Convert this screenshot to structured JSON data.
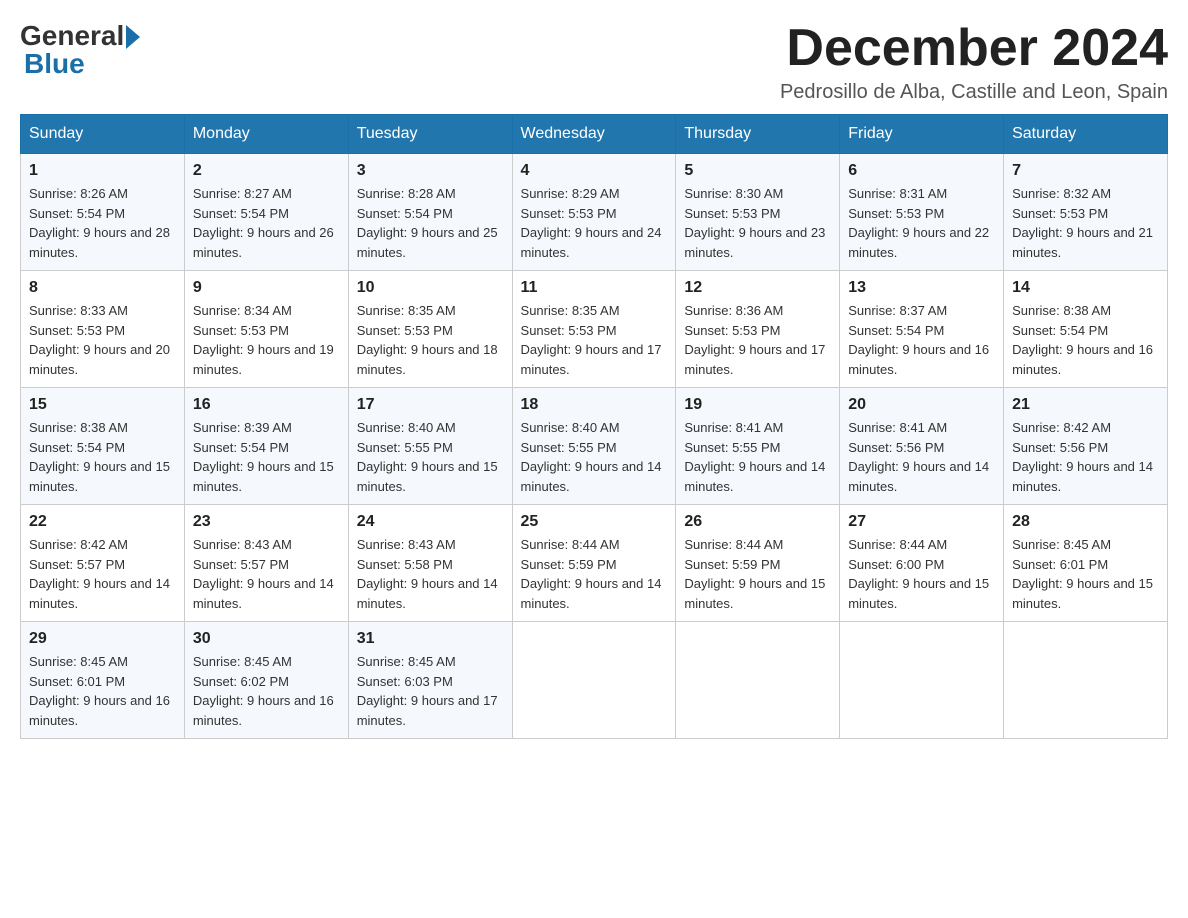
{
  "logo": {
    "general": "General",
    "blue": "Blue"
  },
  "title": "December 2024",
  "location": "Pedrosillo de Alba, Castille and Leon, Spain",
  "days_of_week": [
    "Sunday",
    "Monday",
    "Tuesday",
    "Wednesday",
    "Thursday",
    "Friday",
    "Saturday"
  ],
  "weeks": [
    [
      {
        "day": "1",
        "sunrise": "8:26 AM",
        "sunset": "5:54 PM",
        "daylight": "9 hours and 28 minutes."
      },
      {
        "day": "2",
        "sunrise": "8:27 AM",
        "sunset": "5:54 PM",
        "daylight": "9 hours and 26 minutes."
      },
      {
        "day": "3",
        "sunrise": "8:28 AM",
        "sunset": "5:54 PM",
        "daylight": "9 hours and 25 minutes."
      },
      {
        "day": "4",
        "sunrise": "8:29 AM",
        "sunset": "5:53 PM",
        "daylight": "9 hours and 24 minutes."
      },
      {
        "day": "5",
        "sunrise": "8:30 AM",
        "sunset": "5:53 PM",
        "daylight": "9 hours and 23 minutes."
      },
      {
        "day": "6",
        "sunrise": "8:31 AM",
        "sunset": "5:53 PM",
        "daylight": "9 hours and 22 minutes."
      },
      {
        "day": "7",
        "sunrise": "8:32 AM",
        "sunset": "5:53 PM",
        "daylight": "9 hours and 21 minutes."
      }
    ],
    [
      {
        "day": "8",
        "sunrise": "8:33 AM",
        "sunset": "5:53 PM",
        "daylight": "9 hours and 20 minutes."
      },
      {
        "day": "9",
        "sunrise": "8:34 AM",
        "sunset": "5:53 PM",
        "daylight": "9 hours and 19 minutes."
      },
      {
        "day": "10",
        "sunrise": "8:35 AM",
        "sunset": "5:53 PM",
        "daylight": "9 hours and 18 minutes."
      },
      {
        "day": "11",
        "sunrise": "8:35 AM",
        "sunset": "5:53 PM",
        "daylight": "9 hours and 17 minutes."
      },
      {
        "day": "12",
        "sunrise": "8:36 AM",
        "sunset": "5:53 PM",
        "daylight": "9 hours and 17 minutes."
      },
      {
        "day": "13",
        "sunrise": "8:37 AM",
        "sunset": "5:54 PM",
        "daylight": "9 hours and 16 minutes."
      },
      {
        "day": "14",
        "sunrise": "8:38 AM",
        "sunset": "5:54 PM",
        "daylight": "9 hours and 16 minutes."
      }
    ],
    [
      {
        "day": "15",
        "sunrise": "8:38 AM",
        "sunset": "5:54 PM",
        "daylight": "9 hours and 15 minutes."
      },
      {
        "day": "16",
        "sunrise": "8:39 AM",
        "sunset": "5:54 PM",
        "daylight": "9 hours and 15 minutes."
      },
      {
        "day": "17",
        "sunrise": "8:40 AM",
        "sunset": "5:55 PM",
        "daylight": "9 hours and 15 minutes."
      },
      {
        "day": "18",
        "sunrise": "8:40 AM",
        "sunset": "5:55 PM",
        "daylight": "9 hours and 14 minutes."
      },
      {
        "day": "19",
        "sunrise": "8:41 AM",
        "sunset": "5:55 PM",
        "daylight": "9 hours and 14 minutes."
      },
      {
        "day": "20",
        "sunrise": "8:41 AM",
        "sunset": "5:56 PM",
        "daylight": "9 hours and 14 minutes."
      },
      {
        "day": "21",
        "sunrise": "8:42 AM",
        "sunset": "5:56 PM",
        "daylight": "9 hours and 14 minutes."
      }
    ],
    [
      {
        "day": "22",
        "sunrise": "8:42 AM",
        "sunset": "5:57 PM",
        "daylight": "9 hours and 14 minutes."
      },
      {
        "day": "23",
        "sunrise": "8:43 AM",
        "sunset": "5:57 PM",
        "daylight": "9 hours and 14 minutes."
      },
      {
        "day": "24",
        "sunrise": "8:43 AM",
        "sunset": "5:58 PM",
        "daylight": "9 hours and 14 minutes."
      },
      {
        "day": "25",
        "sunrise": "8:44 AM",
        "sunset": "5:59 PM",
        "daylight": "9 hours and 14 minutes."
      },
      {
        "day": "26",
        "sunrise": "8:44 AM",
        "sunset": "5:59 PM",
        "daylight": "9 hours and 15 minutes."
      },
      {
        "day": "27",
        "sunrise": "8:44 AM",
        "sunset": "6:00 PM",
        "daylight": "9 hours and 15 minutes."
      },
      {
        "day": "28",
        "sunrise": "8:45 AM",
        "sunset": "6:01 PM",
        "daylight": "9 hours and 15 minutes."
      }
    ],
    [
      {
        "day": "29",
        "sunrise": "8:45 AM",
        "sunset": "6:01 PM",
        "daylight": "9 hours and 16 minutes."
      },
      {
        "day": "30",
        "sunrise": "8:45 AM",
        "sunset": "6:02 PM",
        "daylight": "9 hours and 16 minutes."
      },
      {
        "day": "31",
        "sunrise": "8:45 AM",
        "sunset": "6:03 PM",
        "daylight": "9 hours and 17 minutes."
      },
      null,
      null,
      null,
      null
    ]
  ]
}
